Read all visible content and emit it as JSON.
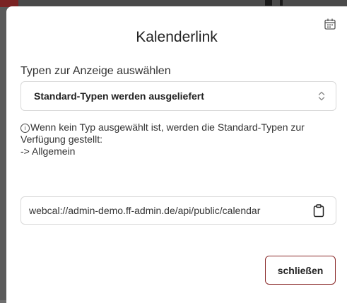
{
  "modal": {
    "title": "Kalenderlink",
    "calendar_icon": "calendar-icon"
  },
  "types": {
    "label": "Typen zur Anzeige auswählen",
    "selected": "Standard-Typen werden ausgeliefert",
    "chevron_icon": "chevron-up-down-icon"
  },
  "hint": {
    "icon": "info-icon",
    "line1": "Wenn kein Typ ausgewählt ist, werden die Standard-Typen zur",
    "line2": "Verfügung gestellt:",
    "line3": "-> Allgemein"
  },
  "link": {
    "value": "webcal://admin-demo.ff-admin.de/api/public/calendar",
    "copy_icon": "clipboard-icon"
  },
  "actions": {
    "close_label": "schließen"
  },
  "colors": {
    "close_border": "#8a2a2a",
    "backdrop": "#5a5a5a"
  }
}
